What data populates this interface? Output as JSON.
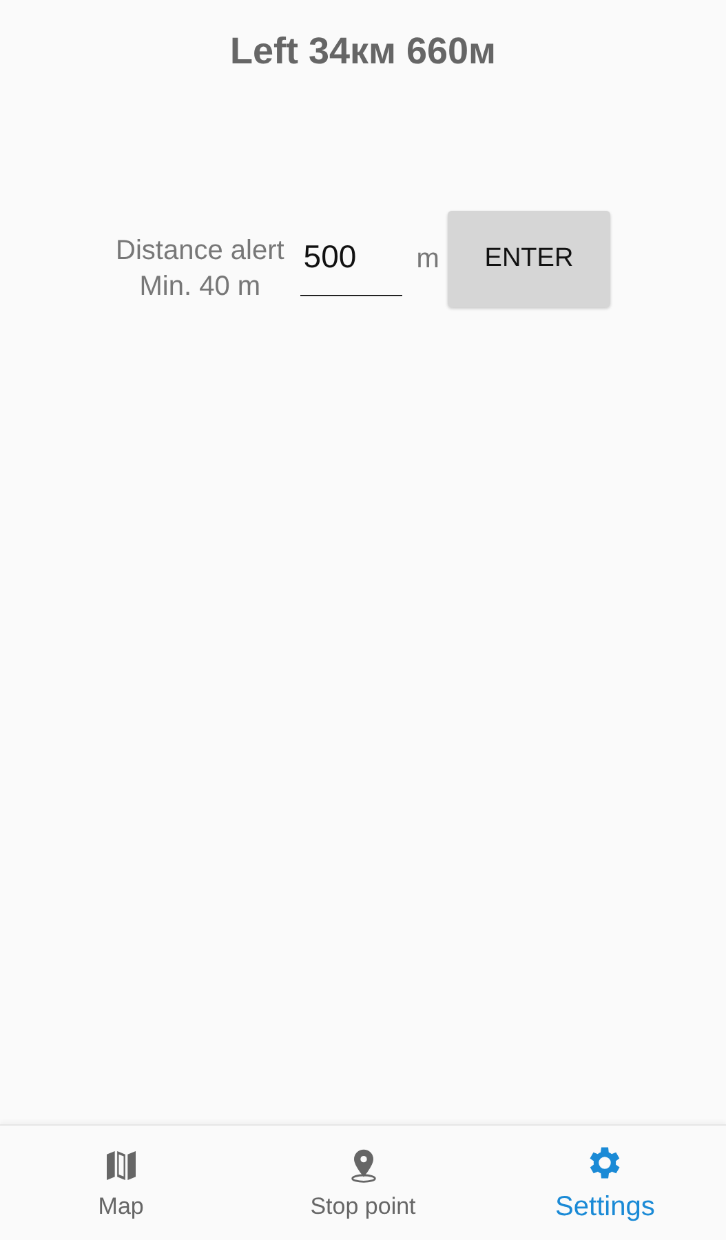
{
  "header": {
    "title": "Left 34км 660м"
  },
  "alert": {
    "label": "Distance alert",
    "hint": "Min. 40 m",
    "value": "500",
    "unit": "m",
    "button": "ENTER"
  },
  "nav": [
    {
      "kind": "map",
      "label": "Map",
      "selected": false
    },
    {
      "kind": "pin",
      "label": "Stop point",
      "selected": false
    },
    {
      "kind": "gear",
      "label": "Settings",
      "selected": true
    }
  ]
}
